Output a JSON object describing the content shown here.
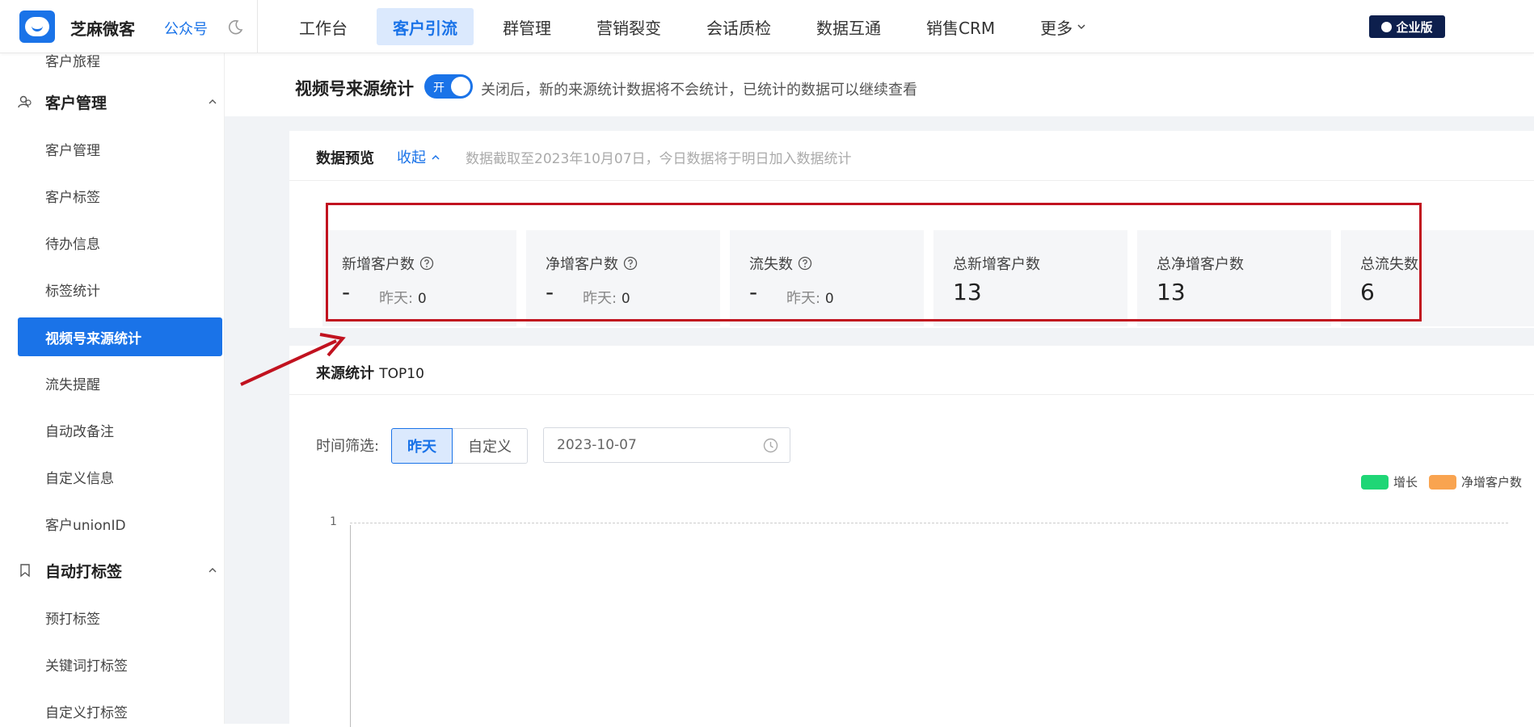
{
  "header": {
    "brand": "芝麻微客",
    "gzh_link": "公众号",
    "nav": [
      "工作台",
      "客户引流",
      "群管理",
      "营销裂变",
      "会话质检",
      "数据互通",
      "销售CRM",
      "更多"
    ],
    "active_nav": "客户引流",
    "enterprise_badge": "企业版"
  },
  "sidebar": {
    "top_clipped": "客户旅程",
    "group1": "客户管理",
    "group1_items": [
      "客户管理",
      "客户标签",
      "待办信息",
      "标签统计",
      "视频号来源统计",
      "流失提醒",
      "自动改备注",
      "自定义信息",
      "客户unionID"
    ],
    "active_item": "视频号来源统计",
    "group2": "自动打标签",
    "group2_items": [
      "预打标签",
      "关键词打标签",
      "自定义打标签"
    ]
  },
  "page": {
    "title": "视频号来源统计",
    "toggle_label": "开",
    "toggle_desc": "关闭后，新的来源统计数据将不会统计，已统计的数据可以继续查看"
  },
  "preview": {
    "title": "数据预览",
    "collapse": "收起",
    "note": "数据截取至2023年10月07日，今日数据将于明日加入数据统计",
    "stats": [
      {
        "label": "新增客户数",
        "value": "-",
        "yesterday_label": "昨天:",
        "yesterday_value": "0",
        "help": true
      },
      {
        "label": "净增客户数",
        "value": "-",
        "yesterday_label": "昨天:",
        "yesterday_value": "0",
        "help": true
      },
      {
        "label": "流失数",
        "value": "-",
        "yesterday_label": "昨天:",
        "yesterday_value": "0",
        "help": true
      },
      {
        "label": "总新增客户数",
        "value": "13"
      },
      {
        "label": "总净增客户数",
        "value": "13"
      },
      {
        "label": "总流失数",
        "value": "6"
      }
    ]
  },
  "source": {
    "title": "来源统计",
    "title_suffix": "TOP10",
    "time_filter_label": "时间筛选:",
    "filter_buttons": [
      "昨天",
      "自定义"
    ],
    "active_filter": "昨天",
    "date_value": "2023-10-07",
    "legend": [
      {
        "name": "增长",
        "color": "#1fd676"
      },
      {
        "name": "净增客户数",
        "color": "#f9a450"
      }
    ],
    "y_tick": "1"
  },
  "colors": {
    "accent": "#1a73e8",
    "highlight": "#c1121f"
  }
}
